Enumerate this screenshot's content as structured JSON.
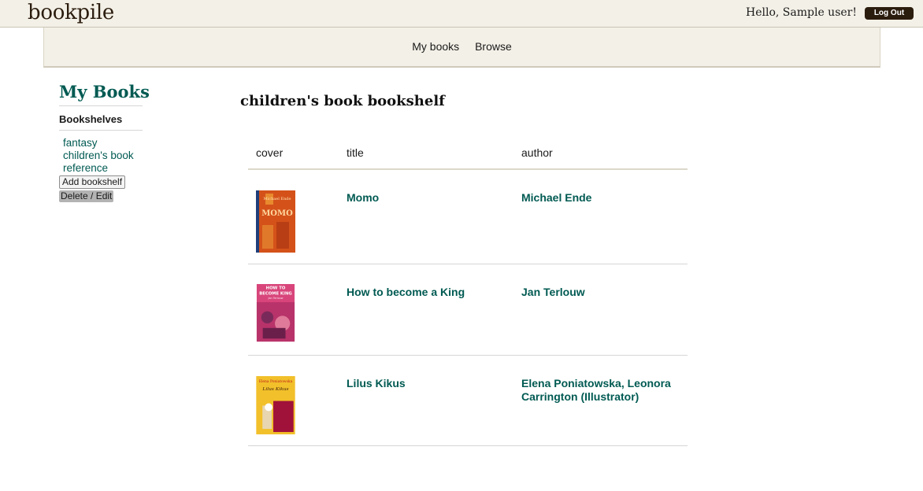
{
  "header": {
    "logo": "bookpile",
    "greeting": "Hello, Sample user!",
    "logout_label": "Log Out"
  },
  "nav": {
    "my_books": "My books",
    "browse": "Browse"
  },
  "sidebar": {
    "title": "My Books",
    "subtitle": "Bookshelves",
    "shelves": [
      "fantasy",
      "children's book",
      "reference"
    ],
    "add_label": "Add bookshelf",
    "delete_label": "Delete / Edit"
  },
  "main": {
    "title": "children's book bookshelf",
    "columns": [
      "cover",
      "title",
      "author"
    ],
    "books": [
      {
        "title": "Momo",
        "author": "Michael Ende",
        "cover_text": [
          "Michael Ende",
          "MOMO"
        ],
        "cover_colors": [
          "#d4521a",
          "#1f3f7a"
        ]
      },
      {
        "title": "How to become a King",
        "author": "Jan Terlouw",
        "cover_text": [
          "HOW TO",
          "BECOME KING",
          "Jan Terlouw"
        ],
        "cover_colors": [
          "#d8457a",
          "#7a2a5a"
        ]
      },
      {
        "title": "Lilus Kikus",
        "author": "Elena Poniatowska, Leonora Carrington (Illustrator)",
        "cover_text": [
          "Elena Poniatowska",
          "Lilus Kikus"
        ],
        "cover_colors": [
          "#f2c02a",
          "#a0123a"
        ]
      }
    ]
  }
}
